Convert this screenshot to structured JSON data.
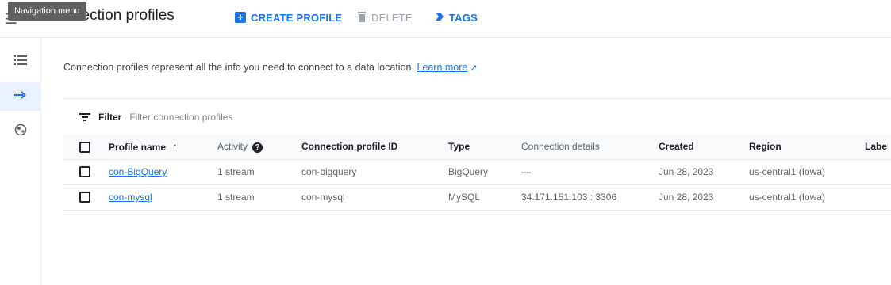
{
  "header": {
    "nav_tooltip": "Navigation menu",
    "title": "nection profiles",
    "create_label": "CREATE PROFILE",
    "delete_label": "DELETE",
    "tags_label": "TAGS"
  },
  "sidenav": {
    "items": [
      {
        "icon": "list-icon",
        "active": false
      },
      {
        "icon": "stream-arrow-icon",
        "active": true
      },
      {
        "icon": "globe-icon",
        "active": false
      }
    ]
  },
  "main": {
    "description": "Connection profiles represent all the info you need to connect to a data location.",
    "learn_more": "Learn more"
  },
  "filter": {
    "label": "Filter",
    "placeholder": "Filter connection profiles"
  },
  "table": {
    "columns": [
      "Profile name",
      "Activity",
      "Connection profile ID",
      "Type",
      "Connection details",
      "Created",
      "Region",
      "Labe"
    ],
    "rows": [
      {
        "name": "con-BigQuery",
        "activity": "1 stream",
        "id": "con-bigquery",
        "type": "BigQuery",
        "details": "—",
        "created": "Jun 28, 2023",
        "region": "us-central1 (Iowa)"
      },
      {
        "name": "con-mysql",
        "activity": "1 stream",
        "id": "con-mysql",
        "type": "MySQL",
        "details": "34.171.151.103 : 3306",
        "created": "Jun 28, 2023",
        "region": "us-central1 (Iowa)"
      }
    ]
  },
  "colors": {
    "accent": "#1a73e8",
    "active_bg": "#e8f0fe"
  }
}
